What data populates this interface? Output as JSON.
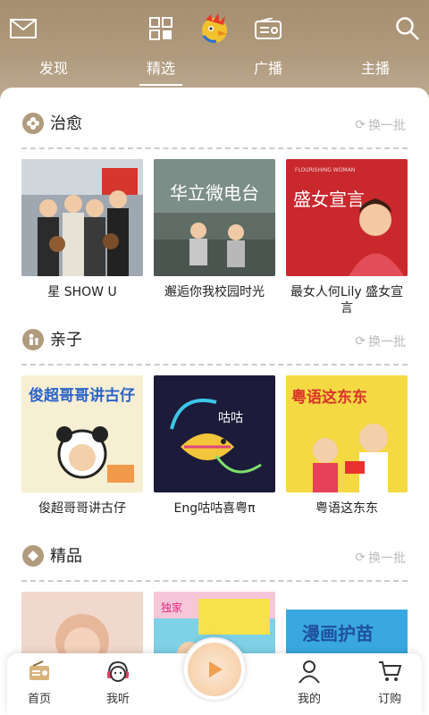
{
  "colors": {
    "header_bg": "#b19b7e",
    "accent": "#b19b7e",
    "muted_text": "#bbbbbb",
    "tab_active": "#ffffff"
  },
  "topbar": {
    "icons": [
      "mail-icon",
      "grid-icon",
      "rooster-logo-icon",
      "radio-icon",
      "search-icon"
    ]
  },
  "tabs": [
    {
      "label": "发现",
      "active": false
    },
    {
      "label": "精选",
      "active": true
    },
    {
      "label": "广播",
      "active": false
    },
    {
      "label": "主播",
      "active": false
    }
  ],
  "sections": [
    {
      "title": "治愈",
      "refresh": "换一批",
      "items": [
        {
          "title": "星 SHOW U"
        },
        {
          "title": "邂逅你我校园时光",
          "thumb_text": "华立微电台"
        },
        {
          "title": "最女人何Lily 盛女宣言",
          "thumb_text": "盛女宣言",
          "thumb_subtext": "FLOURISHING WOMAN"
        }
      ]
    },
    {
      "title": "亲子",
      "refresh": "换一批",
      "items": [
        {
          "title": "俊超哥哥讲古仔",
          "thumb_text": "俊超哥哥讲古仔"
        },
        {
          "title": "Eng咕咕喜粤π",
          "thumb_text": "咕咕"
        },
        {
          "title": "粤语这东东",
          "thumb_text": "粤语这东东"
        }
      ]
    },
    {
      "title": "精品",
      "refresh": "换一批",
      "items": [
        {
          "title": ""
        },
        {
          "title": "",
          "thumb_text": "独家"
        },
        {
          "title": "",
          "thumb_text": "漫画护苗"
        }
      ]
    }
  ],
  "bottom_nav": [
    {
      "label": "首页",
      "icon": "radio-home-icon"
    },
    {
      "label": "我听",
      "icon": "headphones-face-icon"
    },
    {
      "label": "我的",
      "icon": "person-icon"
    },
    {
      "label": "订购",
      "icon": "cart-icon"
    }
  ],
  "player": {
    "icon": "play-icon"
  }
}
